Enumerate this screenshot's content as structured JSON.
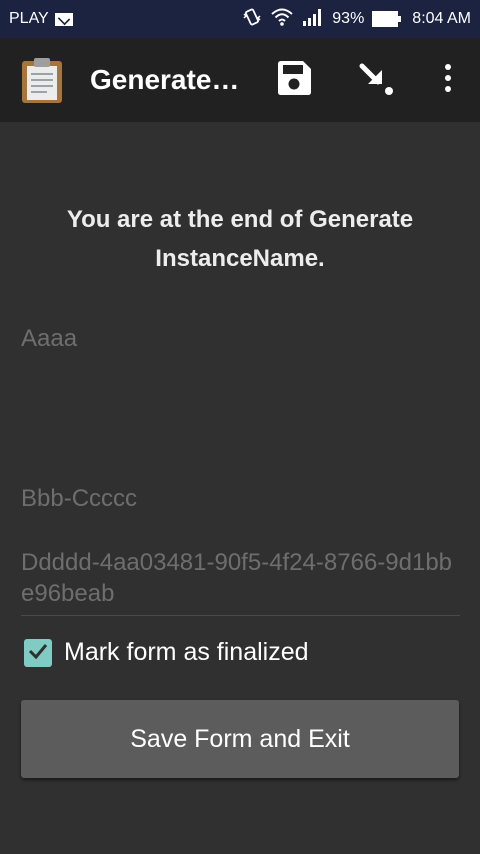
{
  "status_bar": {
    "carrier": "PLAY",
    "battery_percent": "93%",
    "time": "8:04 AM",
    "icons": [
      "mail-icon",
      "vibrate-icon",
      "wifi-icon",
      "signal-icon",
      "battery-icon"
    ]
  },
  "app_bar": {
    "title": "Generate…",
    "actions": [
      "save-icon",
      "go-to-end-icon",
      "more-options-icon"
    ]
  },
  "content": {
    "end_message": "You are at the end of Generate InstanceName.",
    "fields": [
      "Aaaa",
      "Bbb-Ccccc",
      "Ddddd-4aa03481-90f5-4f24-8766-9d1bbe96beab"
    ],
    "mark_finalized": {
      "label": "Mark form as finalized",
      "checked": true
    },
    "save_button_label": "Save Form and Exit"
  },
  "colors": {
    "background": "#303030",
    "status_bar": "#1c2341",
    "app_bar": "#212121",
    "checkbox_accent": "#80cbc4",
    "button": "#5c5c5c"
  }
}
